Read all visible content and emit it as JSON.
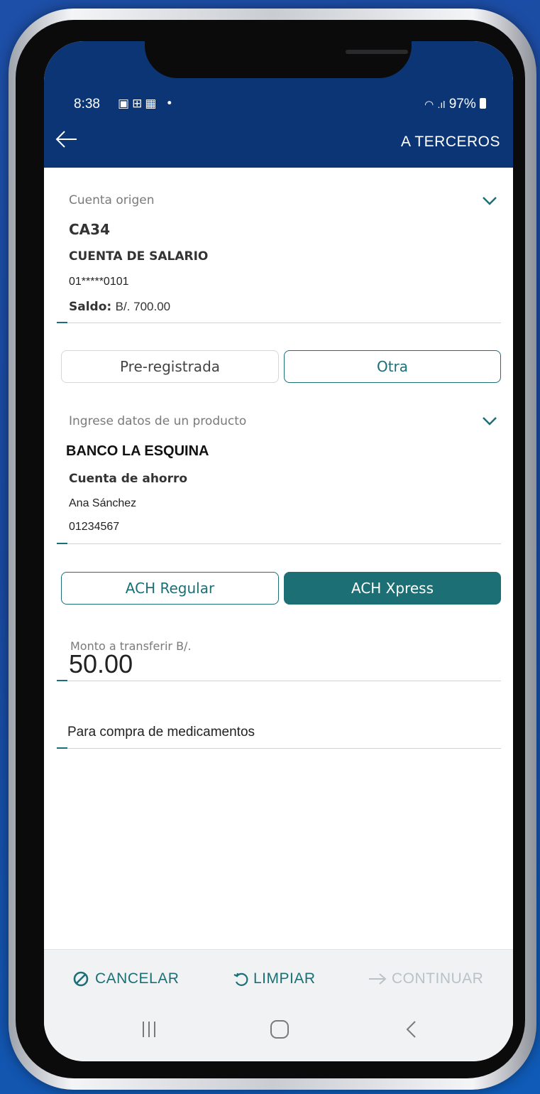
{
  "status_bar": {
    "time": "8:38",
    "left_icons": [
      "gallery-icon",
      "teams-icon",
      "calendar-icon",
      "dot-icon"
    ],
    "battery": "97%"
  },
  "app_bar": {
    "title": "A TERCEROS"
  },
  "origin": {
    "label": "Cuenta origen",
    "code": "CA34",
    "name": "CUENTA DE SALARIO",
    "number": "01*****0101",
    "balance_label": "Saldo:",
    "balance_value": "B/. 700.00"
  },
  "destination_tabs": {
    "preregistered": "Pre-registrada",
    "other": "Otra",
    "selected": "Otra"
  },
  "product": {
    "label": "Ingrese datos de un producto",
    "bank": "BANCO LA ESQUINA",
    "type": "Cuenta de ahorro",
    "holder": "Ana Sánchez",
    "number": "01234567"
  },
  "ach_tabs": {
    "regular": "ACH Regular",
    "xpress": "ACH Xpress",
    "selected": "ACH Xpress"
  },
  "amount": {
    "label": "Monto a transferir B/.",
    "value": "50.00"
  },
  "description": {
    "value": "Para compra de medicamentos"
  },
  "actions": {
    "cancel": "CANCELAR",
    "clear": "LIMPIAR",
    "continue": "CONTINUAR"
  },
  "colors": {
    "app_bar": "#0b3575",
    "accent": "#1b6f75",
    "disabled": "#b9c2c6",
    "background": "#1a49a0"
  }
}
